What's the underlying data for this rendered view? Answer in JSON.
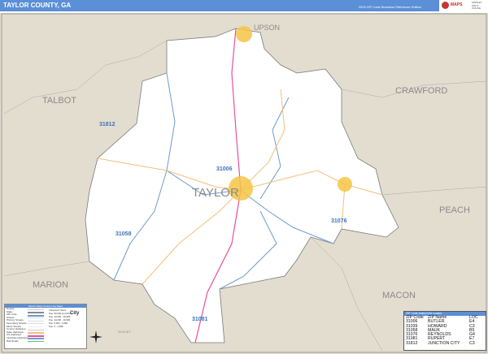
{
  "header": {
    "title": "TAYLOR COUNTY, GA",
    "edition": "2020 ZIP Code Business Reference Edition",
    "logo_text": "MAPS",
    "logo_side": "MARKET MAPS ONLINE"
  },
  "map": {
    "county_label": "TAYLOR",
    "neighbors": [
      "UPSON",
      "TALBOT",
      "CRAWFORD",
      "PEACH",
      "MARION",
      "MACON",
      "SCHLEY"
    ],
    "zip_labels": [
      "31006",
      "31076",
      "31058",
      "31812",
      "31081"
    ],
    "colors": {
      "county_fill": "#ffffff",
      "outside": "#e3ddd0",
      "zip_border": "#6f9ad0",
      "us_highway": "#e8509c",
      "state_highway": "#f2c07a",
      "city": "#f6c445",
      "header": "#5b8fd6"
    }
  },
  "legend": {
    "title": "Market Maps County Line Maps",
    "items": [
      "County",
      "State",
      "ZIP Code",
      "Streets",
      "Primary Streets",
      "Secondary Streets",
      "Minor Streets",
      "County Highways",
      "State Highways",
      "US Highways",
      "Interstate Highways",
      "Rail Roads"
    ],
    "pop_title": "Urbanized Towns",
    "pop": [
      "Pop. 50,000 and Above",
      "Pop. 20,000 - 49,999",
      "Pop. 10,000 - 19,999",
      "Pop. 5,000 - 9,999",
      "Pop. 0 - 4,999"
    ],
    "city_label": "City"
  },
  "zip_index": {
    "title": "ZIP Code Index/Grid Locator",
    "headers": [
      "ZIP Code",
      "ZIP Name",
      "LOC"
    ],
    "rows": [
      [
        "31006",
        "BUTLER",
        "E4"
      ],
      [
        "31039",
        "HOWARD",
        "C3"
      ],
      [
        "31058",
        "MAUK",
        "B5"
      ],
      [
        "31076",
        "REYNOLDS",
        "G4"
      ],
      [
        "31081",
        "RUPERT",
        "E7"
      ],
      [
        "31812",
        "JUNCTION CITY",
        "C3"
      ]
    ]
  }
}
